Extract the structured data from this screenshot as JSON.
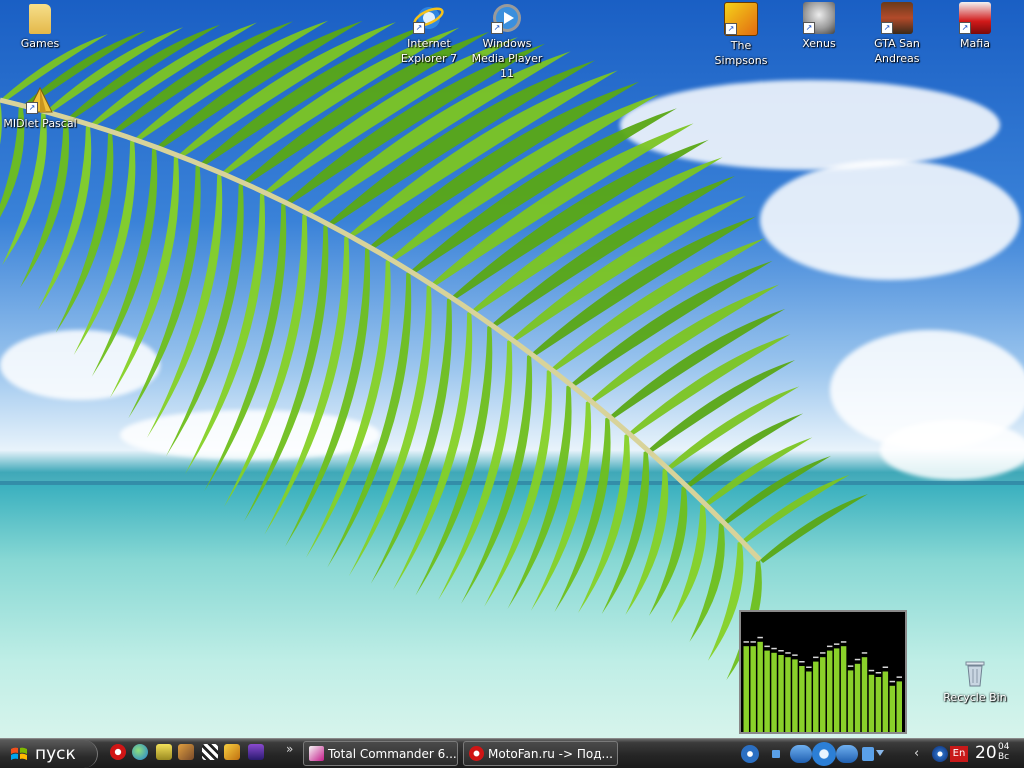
{
  "desktop": {
    "icons": [
      {
        "label": "Games"
      },
      {
        "label": "MIDlet Pascal"
      },
      {
        "label": "Internet Explorer 7"
      },
      {
        "label": "Windows Media Player 11"
      },
      {
        "label": "The Simpsons"
      },
      {
        "label": "Xenus"
      },
      {
        "label": "GTA San Andreas"
      },
      {
        "label": "Mafia"
      },
      {
        "label": "Recycle Bin"
      }
    ]
  },
  "visualizer": {
    "levels": [
      0.78,
      0.78,
      0.82,
      0.74,
      0.72,
      0.7,
      0.68,
      0.66,
      0.6,
      0.55,
      0.64,
      0.68,
      0.74,
      0.76,
      0.78,
      0.56,
      0.62,
      0.68,
      0.52,
      0.5,
      0.55,
      0.42,
      0.46
    ],
    "bar_color": "#8ad12a"
  },
  "taskbar": {
    "start_label": "пуск",
    "quick_launch": [
      {
        "icon": "opera-icon"
      },
      {
        "icon": "globe-icon"
      },
      {
        "icon": "keyboard-icon"
      },
      {
        "icon": "network-icon"
      },
      {
        "icon": "spyware-icon"
      },
      {
        "icon": "flash-icon"
      },
      {
        "icon": "floppy-icon"
      }
    ],
    "chevron": "»",
    "tasks": [
      {
        "label": "Total Commander 6...",
        "icon": "total-commander-icon"
      },
      {
        "label": "MotoFan.ru -> Под...",
        "icon": "opera-icon"
      }
    ],
    "tray": {
      "language": "En",
      "clock_hour": "20",
      "clock_minute": "04",
      "day": "Вс"
    }
  },
  "colors": {
    "taskbar_top": "#6a6a6a",
    "taskbar_bottom": "#1a1a1a",
    "lang_badge": "#c81919"
  }
}
